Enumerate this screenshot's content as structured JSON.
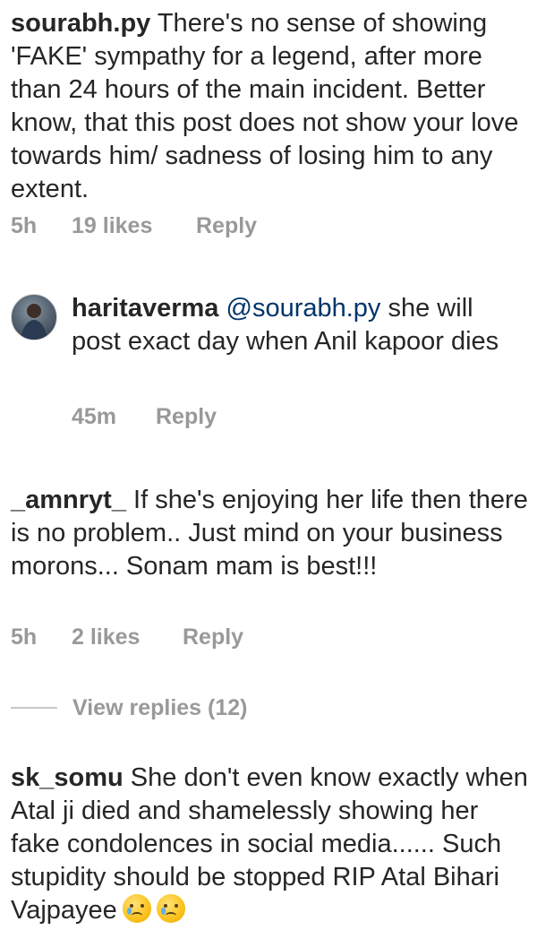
{
  "comments": [
    {
      "username": "sourabh.py",
      "text": " There's no sense of showing 'FAKE' sympathy for a legend, after more than 24 hours of the main incident. Better know, that this post does not show your love towards him/ sadness of losing him to any extent.",
      "time": "5h",
      "likes": "19 likes",
      "reply": "Reply"
    },
    {
      "username": "_amnryt_",
      "text": " If she's enjoying her life then there is no problem.. Just mind on your business morons... Sonam mam is best!!!",
      "time": "5h",
      "likes": "2 likes",
      "reply": "Reply"
    },
    {
      "username": "sk_somu",
      "text": " She don't even know exactly when Atal ji died and shamelessly showing her fake condolences in social media...... Such stupidity should be stopped RIP Atal Bihari Vajpayee",
      "emojis": [
        "crying-face-emoji",
        "crying-face-emoji"
      ]
    }
  ],
  "reply": {
    "username": "haritaverma",
    "mention": "@sourabh.py",
    "text": " she will post exact day when Anil kapoor dies",
    "time": "45m",
    "reply": "Reply"
  },
  "view_replies": "View replies (12)"
}
